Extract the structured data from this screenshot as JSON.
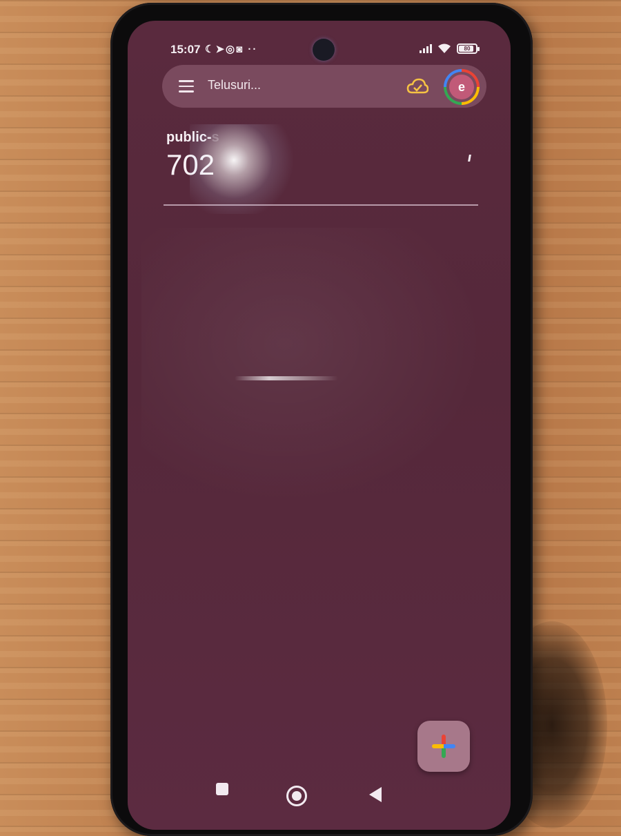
{
  "status_bar": {
    "time": "15:07",
    "left_icons": [
      "moon-icon",
      "telegram-icon",
      "whatsapp-icon",
      "instagram-icon",
      "more-dots-icon"
    ],
    "left_icons_text": "☾➤◎◙ ··",
    "battery_text": "80"
  },
  "search": {
    "placeholder": "Telusuri..."
  },
  "account": {
    "avatar_initial": "e"
  },
  "wifi_info": {
    "label": "public-",
    "label_partial": "s",
    "value": "702"
  },
  "colors": {
    "screen_bg": "#5a2a3e",
    "search_bar_bg": "#7a4a5e",
    "fab_bg": "#a7788a",
    "avatar_bg": "#c15a78"
  }
}
